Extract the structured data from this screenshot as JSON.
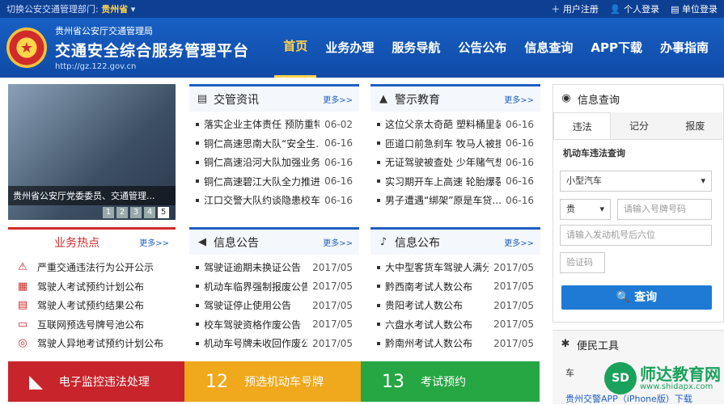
{
  "topbar": {
    "switch_label": "切换公安交通管理部门:",
    "province": "贵州省",
    "register": "用户注册",
    "login": "个人登录",
    "unit_login": "单位登录"
  },
  "brand": {
    "subtitle": "贵州省公安厅交通管理局",
    "title": "交通安全综合服务管理平台",
    "url": "http://gz.122.gov.cn"
  },
  "nav": [
    "首页",
    "业务办理",
    "服务导航",
    "公告公布",
    "信息查询",
    "APP下载",
    "办事指南"
  ],
  "slider": {
    "caption": "贵州省公安厅党委委员、交通管理...",
    "pages": [
      "1",
      "2",
      "3",
      "4",
      "5"
    ]
  },
  "news": {
    "title": "交管资讯",
    "more": "更多>>",
    "items": [
      {
        "t": "落实企业主体责任 预防重特...",
        "d": "06-02"
      },
      {
        "t": "铜仁高速思南大队“安全生...",
        "d": "06-16"
      },
      {
        "t": "铜仁高速沿河大队加强业务...",
        "d": "06-16"
      },
      {
        "t": "铜仁高速碧江大队全力推进...",
        "d": "06-16"
      },
      {
        "t": "江口交警大队约谈隐患校车...",
        "d": "06-16"
      }
    ]
  },
  "warning": {
    "title": "警示教育",
    "more": "更多>>",
    "items": [
      {
        "t": "这位父亲太奇葩 塑料桶里装...",
        "d": "06-16"
      },
      {
        "t": "匝道口前急刹车 牧马人被撞...",
        "d": "06-16"
      },
      {
        "t": "无证驾驶被查处 少年赌气想...",
        "d": "06-16"
      },
      {
        "t": "实习期开车上高速 轮胎爆裂...",
        "d": "06-16"
      },
      {
        "t": "男子遭遇“绑架”原是车贷...",
        "d": "06-16"
      }
    ]
  },
  "hot": {
    "title": "业务热点",
    "more": "更多>>",
    "items": [
      {
        "icon": "warning-icon",
        "g": "⚠",
        "t": "严重交通违法行为公开公示"
      },
      {
        "icon": "calendar-icon",
        "g": "▦",
        "t": "驾驶人考试预约计划公布"
      },
      {
        "icon": "calendar-check-icon",
        "g": "▤",
        "t": "驾驶人考试预约结果公布"
      },
      {
        "icon": "plate-icon",
        "g": "▭",
        "t": "互联网预选号牌号池公布"
      },
      {
        "icon": "location-icon",
        "g": "◎",
        "t": "驾驶人异地考试预约计划公布"
      }
    ]
  },
  "info_notice": {
    "title": "信息公告",
    "more": "更多>>",
    "items": [
      {
        "t": "驾驶证逾期未换证公告",
        "d": "2017/05"
      },
      {
        "t": "机动车临界强制报废公告",
        "d": "2017/05"
      },
      {
        "t": "驾驶证停止使用公告",
        "d": "2017/05"
      },
      {
        "t": "校车驾驶资格作废公告",
        "d": "2017/05"
      },
      {
        "t": "机动车号牌未收回作废公告",
        "d": "2017/05"
      }
    ]
  },
  "info_release": {
    "title": "信息公布",
    "more": "更多>>",
    "items": [
      {
        "t": "大中型客货车驾驶人满分公布",
        "d": "2017/05"
      },
      {
        "t": "黔西南考试人数公布",
        "d": "2017/05"
      },
      {
        "t": "贵阳考试人数公布",
        "d": "2017/05"
      },
      {
        "t": "六盘水考试人数公布",
        "d": "2017/05"
      },
      {
        "t": "黔南州考试人数公布",
        "d": "2017/05"
      }
    ]
  },
  "banners": [
    {
      "label": "电子监控违法处理",
      "color": "#c8242b",
      "icon": "camera-icon",
      "g": "◣"
    },
    {
      "label": "预选机动车号牌",
      "color": "#f0a81c",
      "icon": "plate-number-icon",
      "g": "12"
    },
    {
      "label": "考试预约",
      "color": "#27a644",
      "icon": "calendar-13-icon",
      "g": "13"
    }
  ],
  "query": {
    "title": "信息查询",
    "tabs": [
      "违法",
      "记分",
      "报废"
    ],
    "subtitle": "机动车违法查询",
    "vehicle_type": "小型汽车",
    "province_short": "贵",
    "plate_placeholder": "请输入号牌号码",
    "engine_placeholder": "请输入发动机号后六位",
    "captcha_placeholder": "验证码",
    "submit": "查询"
  },
  "tools": {
    "title": "便民工具",
    "item1": "车",
    "item2": "贵州交警APP（iPhone版）下载"
  },
  "watermark": {
    "badge": "SD",
    "name": "师达教育网",
    "url": "www.shidapx.com"
  }
}
